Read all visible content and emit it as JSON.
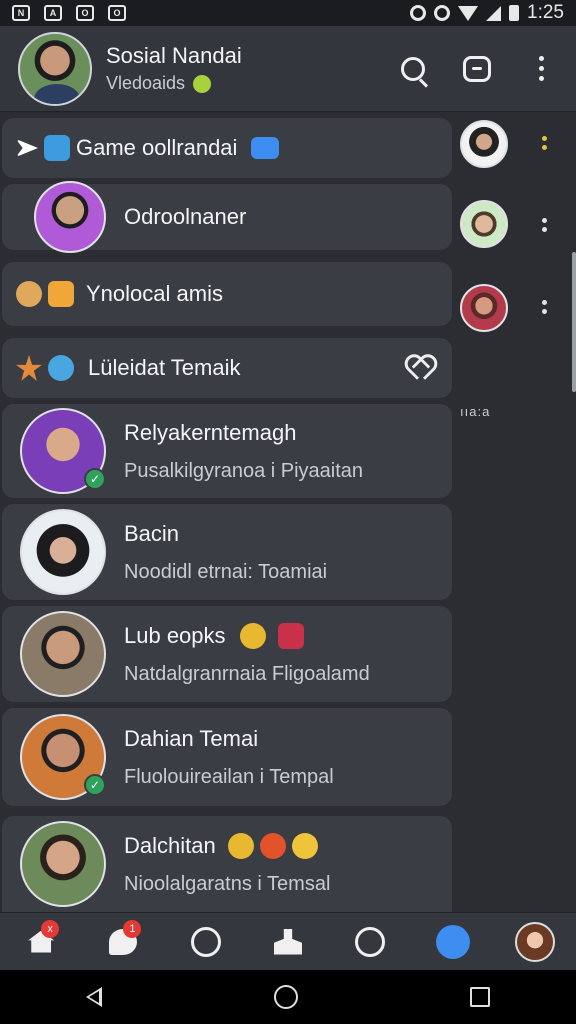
{
  "status_bar": {
    "time": "1:25",
    "left_icons": [
      "n-icon",
      "a-icon",
      "o-icon",
      "o-icon"
    ]
  },
  "header": {
    "title": "Sosial Nandai",
    "subtitle": "Vledoaids"
  },
  "menu_items": [
    {
      "label": "Game oollrandai"
    },
    {
      "label": "Odroolnaner"
    },
    {
      "label": "Ynolocal amis"
    },
    {
      "label": "Lüleidat Temaik"
    }
  ],
  "contacts": [
    {
      "name": "Relyakerntemagh",
      "message": "Pusalkilgyranoa i Piyaaitan",
      "online": true
    },
    {
      "name": "Bacin",
      "message": "Noodidl etrnai: Toamiai",
      "online": false
    },
    {
      "name": "Lub eopks",
      "message": "Natdalgranrnaia Fligoalamd",
      "online": false
    },
    {
      "name": "Dahian Temai",
      "message": "Fluolouireailan i Tempal",
      "online": true
    },
    {
      "name": "Dalchitan",
      "message": "Nioolalgaratns i Temsal",
      "online": false
    }
  ],
  "rail": {
    "text": "ııa:a"
  },
  "bottom_nav": {
    "home_badge": "x",
    "chat_badge": "1"
  },
  "colors": {
    "background": "#2b2d32",
    "card": "#3a3d43",
    "online": "#2fa35b",
    "badge": "#e53935",
    "accent_blue": "#3d8ef0"
  }
}
